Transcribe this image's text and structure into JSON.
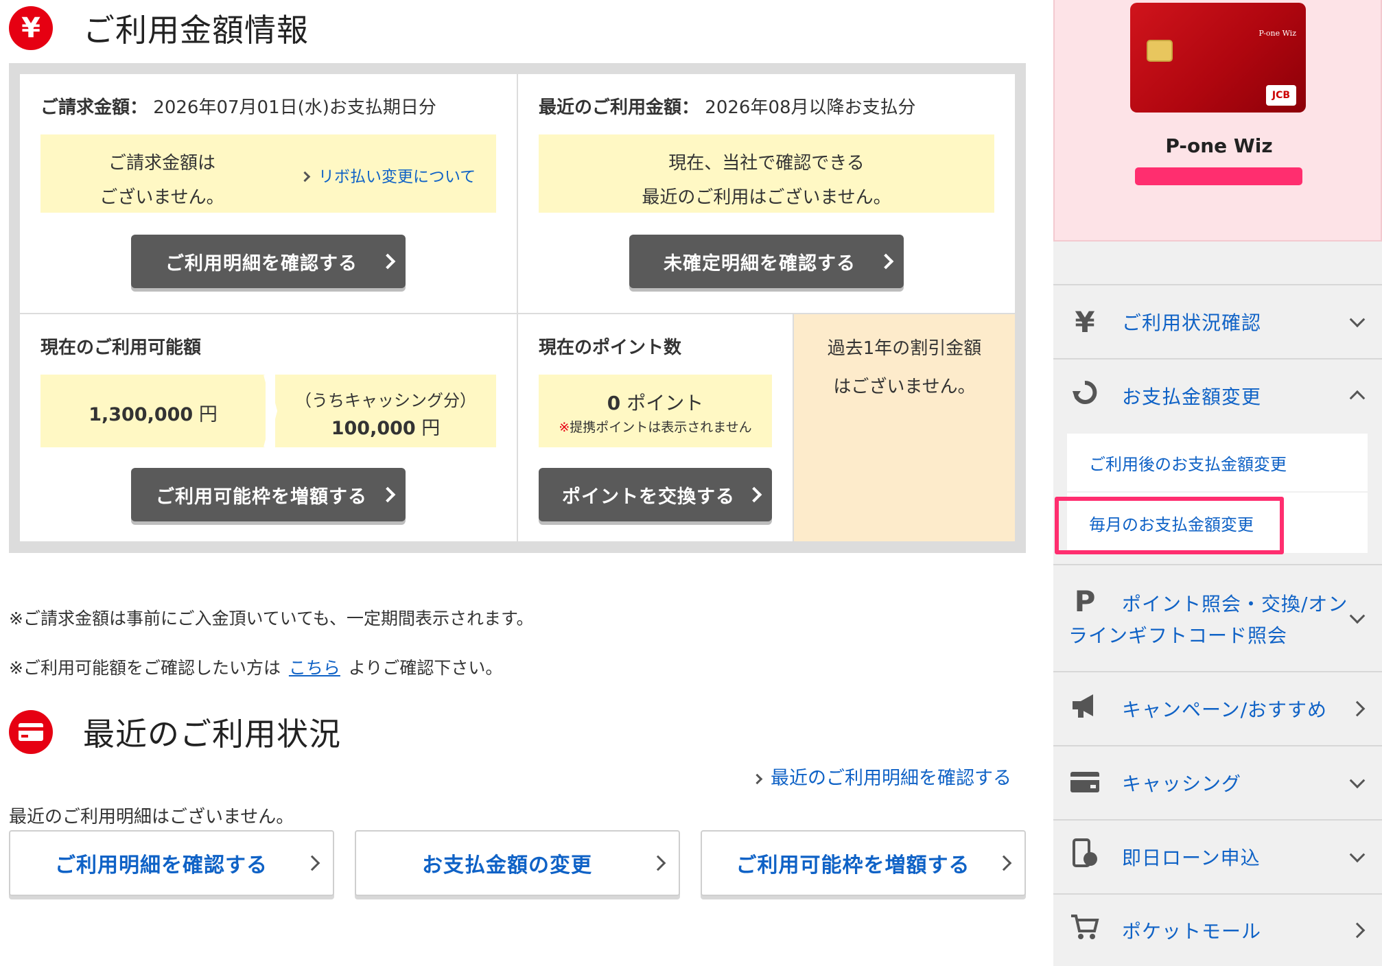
{
  "usage_info": {
    "title": "ご利用金額情報",
    "icon": "yen-icon",
    "billing": {
      "label": "ご請求金額：",
      "period": "2026年07月01日(水)お支払期日分",
      "message_line1": "ご請求金額は",
      "message_line2": "ございません。",
      "revo_link": "リボ払い変更について",
      "button": "ご利用明細を確認する"
    },
    "recent": {
      "label": "最近のご利用金額：",
      "period": "2026年08月以降お支払分",
      "message_line1": "現在、当社で確認できる",
      "message_line2": "最近のご利用はございません。",
      "button": "未確定明細を確認する"
    },
    "available": {
      "label": "現在のご利用可能額",
      "amount": "1,300,000",
      "unit": "円",
      "cashing_label": "（うちキャッシング分）",
      "cashing_amount": "100,000",
      "cashing_unit": "円",
      "button": "ご利用可能枠を増額する"
    },
    "points": {
      "label": "現在のポイント数",
      "value": "0",
      "unit": "ポイント",
      "note_mark": "※",
      "note": "提携ポイントは表示されません",
      "button": "ポイントを交換する"
    },
    "discount": {
      "line1": "過去1年の割引金額",
      "line2": "はございません。"
    }
  },
  "notes": {
    "note1": "※ご請求金額は事前にご入金頂いていても、一定期間表示されます。",
    "note2_prefix": "※ご利用可能額をご確認したい方は",
    "note2_link": "こちら",
    "note2_suffix": "よりご確認下さい。"
  },
  "recent_usage": {
    "title": "最近のご利用状況",
    "icon": "credit-card-icon",
    "detail_link": "最近のご利用明細を確認する",
    "empty_message": "最近のご利用明細はございません。",
    "buttons": [
      "ご利用明細を確認する",
      "お支払金額の変更",
      "ご利用可能枠を増額する"
    ]
  },
  "sidebar": {
    "card_name": "P-one Wiz",
    "card_brand": "P-one Wiz",
    "card_network": "JCB",
    "menu": [
      {
        "label": "ご利用状況確認",
        "icon": "yen-icon"
      },
      {
        "label": "お支払金額変更",
        "icon": "refresh-icon"
      },
      {
        "label_line1": "ポイント照会・交換/オン",
        "label_line2": "ラインギフトコード照会",
        "icon": "point-icon"
      },
      {
        "label": "キャンペーン/おすすめ",
        "icon": "megaphone-icon"
      },
      {
        "label": "キャッシング",
        "icon": "card-icon"
      },
      {
        "label": "即日ローン申込",
        "icon": "phone-icon"
      },
      {
        "label": "ポケットモール",
        "icon": "cart-icon"
      }
    ],
    "submenu": [
      "ご利用後のお支払金額変更",
      "毎月のお支払金額変更"
    ]
  },
  "colors": {
    "accent_red": "#e60012",
    "link_blue": "#0f62c6",
    "highlight_pink": "#ff2e6f",
    "yellow_bg": "#fff8c4",
    "peach_bg": "#fdebcb"
  }
}
